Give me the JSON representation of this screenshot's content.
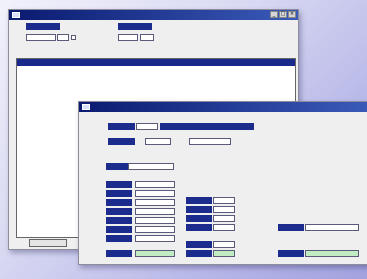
{
  "back_window": {
    "title": "",
    "labels": {
      "left": "",
      "right": ""
    },
    "fields": {
      "a": "",
      "b": "",
      "c": "",
      "d": ""
    },
    "checkbox_label": "",
    "table": {
      "columns": [
        "",
        "",
        "",
        "",
        "",
        ""
      ],
      "row1": [
        "",
        "",
        "",
        "",
        "",
        ""
      ]
    },
    "footer_nav": "",
    "bottom_button": "",
    "side_button": ""
  },
  "front_window": {
    "title": "",
    "header": {
      "label1": "",
      "value1a": "",
      "value1b": "",
      "label2": "",
      "value2a": "",
      "value2b": ""
    },
    "section_label": "",
    "left_labels": [
      "",
      "",
      "",
      "",
      "",
      "",
      "",
      ""
    ],
    "right_labels": [
      "",
      "",
      "",
      "",
      "",
      ""
    ],
    "right_values": [
      "",
      "",
      "",
      "",
      "",
      ""
    ],
    "bottom_right_label": "",
    "bottom_left_label": "",
    "bottom_right2_label": ""
  }
}
